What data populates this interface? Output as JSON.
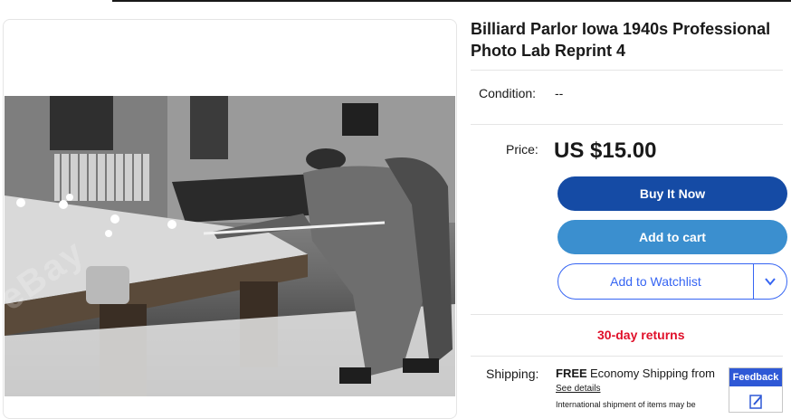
{
  "listing": {
    "title": "Billiard Parlor Iowa 1940s Professional Photo Lab Reprint 4",
    "watermark": "eBay"
  },
  "condition": {
    "label": "Condition:",
    "value": "--"
  },
  "price": {
    "label": "Price:",
    "value": "US $15.00"
  },
  "buttons": {
    "buy_now": "Buy It Now",
    "add_to_cart": "Add to cart",
    "add_to_watchlist": "Add to Watchlist"
  },
  "returns": {
    "text": "30-day returns"
  },
  "shipping": {
    "label": "Shipping:",
    "free": "FREE",
    "description": "Economy Shipping from",
    "see_details": "See details",
    "international_note": "International shipment of items may be"
  },
  "feedback": {
    "label": "Feedback"
  },
  "colors": {
    "buy_now": "#154ba5",
    "add_to_cart": "#3b8fcf",
    "watchlist": "#3665f3",
    "returns": "#e0102a",
    "feedback": "#2e58d6"
  },
  "icons": {
    "watchlist_dropdown": "chevron-down-icon",
    "feedback": "pencil-note-icon"
  }
}
